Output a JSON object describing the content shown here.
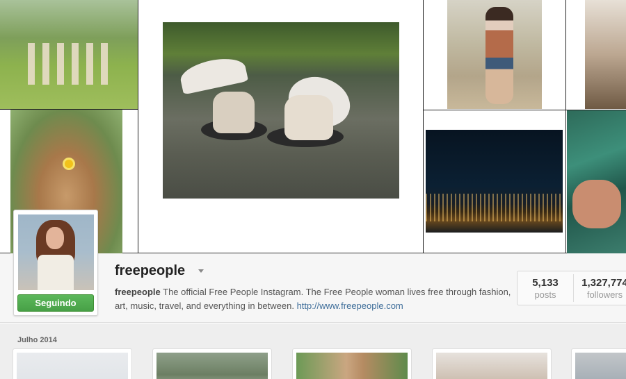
{
  "profile": {
    "username": "freepeople",
    "follow_button": "Seguindo",
    "bio_name": "freepeople",
    "bio_text": " The official Free People Instagram. The Free People woman lives free through fashion, art, music, travel, and everything in between. ",
    "bio_link": "http://www.freepeople.com"
  },
  "stats": {
    "posts_value": "5,133",
    "posts_label": "posts",
    "followers_value": "1,327,774",
    "followers_label": "followers"
  },
  "feed": {
    "month_label": "Julho 2014"
  },
  "colors": {
    "follow_green": "#4cae4b",
    "link_blue": "#3f6e9a",
    "bar_bg": "#f6f6f6"
  },
  "icons": {
    "username_menu": "caret-down-icon"
  }
}
